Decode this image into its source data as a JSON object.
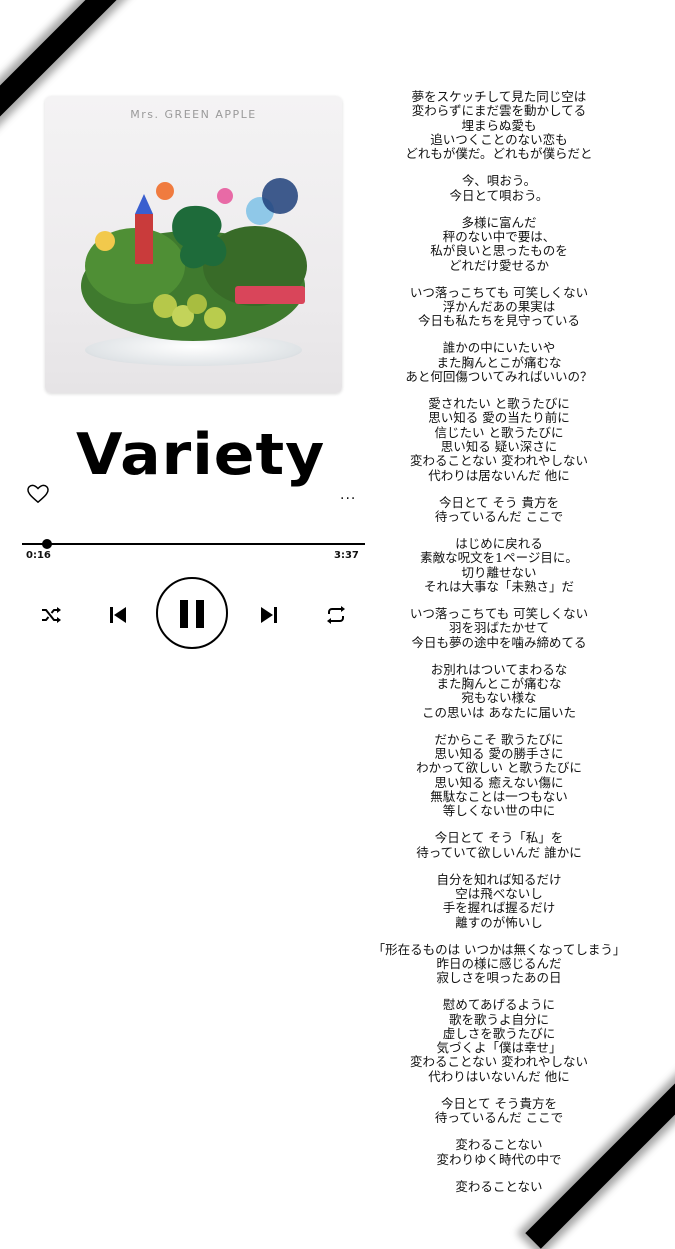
{
  "album": {
    "artist": "Mrs. GREEN APPLE"
  },
  "song": {
    "title": "Variety"
  },
  "player": {
    "current_time": "0:16",
    "total_time": "3:37",
    "progress": 0.074,
    "more_label": "..."
  },
  "icons": {
    "heart": "heart-outline",
    "more": "ellipsis",
    "shuffle": "shuffle",
    "previous": "skip-previous",
    "pause": "pause",
    "next": "skip-next",
    "repeat": "repeat"
  },
  "lyrics": [
    [
      "夢をスケッチして見た同じ空は",
      "変わらずにまだ雲を動かしてる",
      "埋まらぬ愛も",
      "追いつくことのない恋も",
      "どれもが僕だ。どれもが僕らだと"
    ],
    [
      "今、唄おう。",
      "今日とて唄おう。"
    ],
    [
      "多様に富んだ",
      "秤のない中で要は、",
      "私が良いと思ったものを",
      "どれだけ愛せるか"
    ],
    [
      "いつ落っこちても 可笑しくない",
      "浮かんだあの果実は",
      "今日も私たちを見守っている"
    ],
    [
      "誰かの中にいたいや",
      "また胸んとこが痛むな",
      "あと何回傷ついてみればいいの？"
    ],
    [
      "愛されたい と歌うたびに",
      "思い知る 愛の当たり前に",
      "信じたい と歌うたびに",
      "思い知る 疑い深さに",
      "変わることない 変われやしない",
      "代わりは居ないんだ 他に"
    ],
    [
      "今日とて そう 貴方を",
      "待っているんだ ここで"
    ],
    [
      "はじめに戻れる",
      "素敵な呪文を1ページ目に。",
      "切り離せない",
      "それは大事な「未熟さ」だ"
    ],
    [
      "いつ落っこちても 可笑しくない",
      "羽を羽ばたかせて",
      "今日も夢の途中を噛み締めてる"
    ],
    [
      "お別れはついてまわるな",
      "また胸んとこが痛むな",
      "宛もない様な",
      "この思いは あなたに届いた"
    ],
    [
      "だからこそ 歌うたびに",
      "思い知る 愛の勝手さに",
      "わかって欲しい と歌うたびに",
      "思い知る 癒えない傷に",
      "無駄なことは一つもない",
      "等しくない世の中に"
    ],
    [
      "今日とて そう「私」を",
      "待っていて欲しいんだ 誰かに"
    ],
    [
      "自分を知れば知るだけ",
      "空は飛べないし",
      "手を握れば握るだけ",
      "離すのが怖いし"
    ],
    [
      "「形在るものは いつかは無くなってしまう」",
      "昨日の様に感じるんだ",
      "寂しさを唄ったあの日"
    ],
    [
      "慰めてあげるように",
      "歌を歌うよ自分に",
      "虚しさを歌うたびに",
      "気づくよ「僕は幸せ」",
      "変わることない 変われやしない",
      "代わりはいないんだ 他に"
    ],
    [
      "今日とて そう貴方を",
      "待っているんだ ここで"
    ],
    [
      "変わることない",
      "変わりゆく時代の中で"
    ],
    [
      "変わることない"
    ]
  ]
}
